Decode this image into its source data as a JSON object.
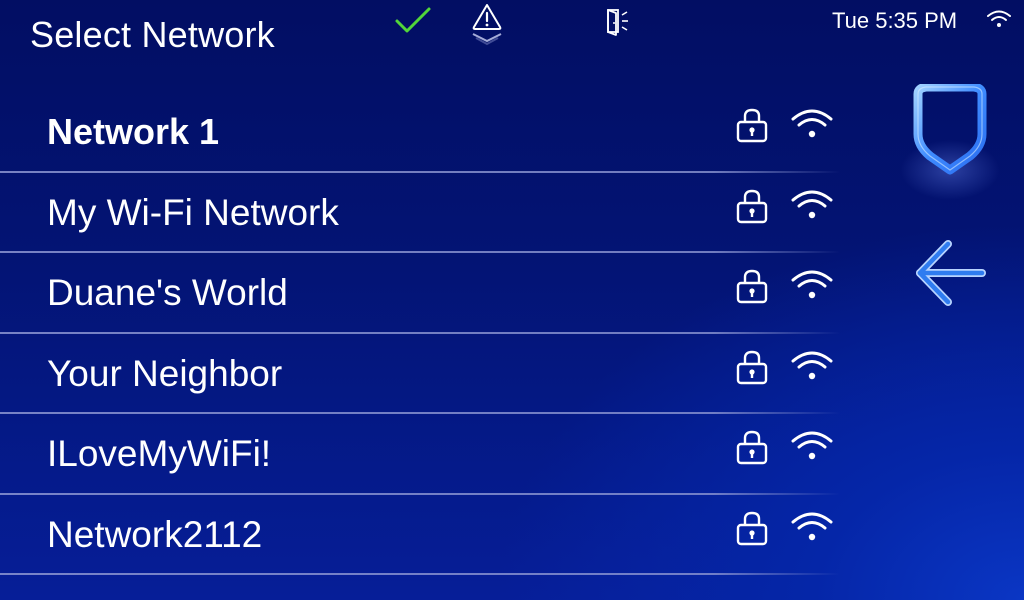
{
  "header": {
    "title": "Select Network",
    "status_icons": [
      "check-icon",
      "alert-triangle-icon",
      "door-open-icon"
    ],
    "clock": "Tue 5:35 PM",
    "wifi_status_icon": "wifi-icon"
  },
  "colors": {
    "check": "#52d63a",
    "accent_blue": "#3f8cff",
    "text": "#ffffff"
  },
  "networks": [
    {
      "name": "Network 1",
      "selected": true,
      "secured": true,
      "signal": "full"
    },
    {
      "name": "My Wi-Fi Network",
      "selected": false,
      "secured": true,
      "signal": "full"
    },
    {
      "name": "Duane's World",
      "selected": false,
      "secured": true,
      "signal": "full"
    },
    {
      "name": "Your Neighbor",
      "selected": false,
      "secured": true,
      "signal": "full"
    },
    {
      "name": "ILoveMyWiFi!",
      "selected": false,
      "secured": true,
      "signal": "full"
    },
    {
      "name": "Network2112",
      "selected": false,
      "secured": true,
      "signal": "full"
    }
  ],
  "side_panel": {
    "shield_icon": "shield-icon",
    "back_icon": "back-arrow-icon"
  }
}
